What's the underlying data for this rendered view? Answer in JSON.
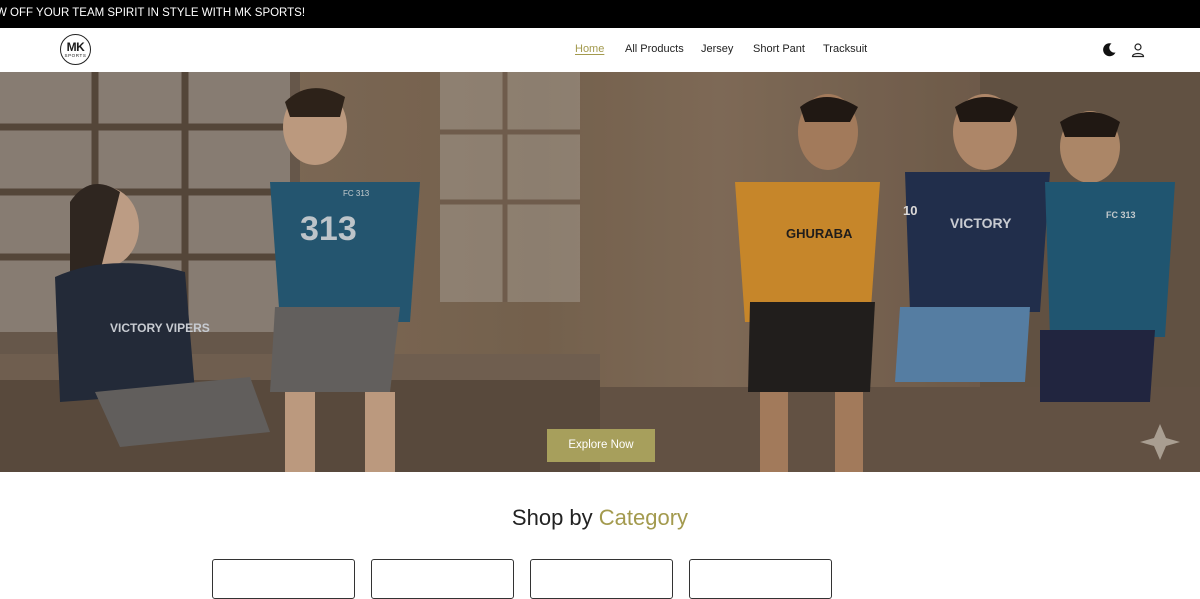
{
  "announcement": "W OFF YOUR TEAM SPIRIT IN STYLE WITH MK SPORTS!",
  "logo": {
    "main": "MK",
    "sub": "SPORTS"
  },
  "nav": {
    "items": [
      {
        "label": "Home",
        "active": true
      },
      {
        "label": "All Products"
      },
      {
        "label": "Jersey"
      },
      {
        "label": "Short Pant"
      },
      {
        "label": "Tracksuit"
      }
    ]
  },
  "header_icons": [
    "moon-icon",
    "user-icon"
  ],
  "hero": {
    "button_label": "Explore Now",
    "jersey_texts": [
      "FC 313",
      "313",
      "VICTORY VIPERS",
      "GHURABA",
      "VICTORY",
      "10",
      "FC 313"
    ]
  },
  "shop_section": {
    "title_main": "Shop by",
    "title_accent": "Category"
  },
  "colors": {
    "accent": "#a79f5c",
    "announcement_bg": "#000000"
  }
}
